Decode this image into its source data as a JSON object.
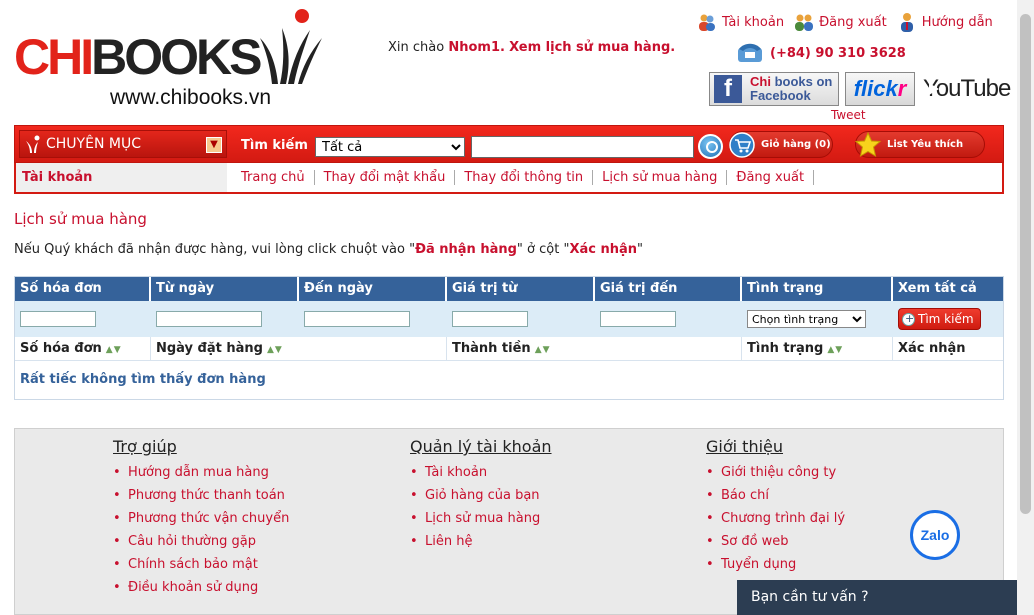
{
  "header": {
    "logo_chi": "CHI",
    "logo_books": "BOOKS",
    "logo_url": "www.chibooks.vn",
    "greeting_prefix": "Xin chào",
    "greeting_user": "Nhom1.",
    "greeting_history": "Xem lịch sử mua hàng.",
    "links": [
      {
        "label": "Tài khoản",
        "icon": "users-icon"
      },
      {
        "label": "Đăng xuất",
        "icon": "logout-icon"
      },
      {
        "label": "Hướng dẫn",
        "icon": "help-person-icon"
      }
    ],
    "phone": "(+84) 90 310 3628",
    "facebook_line1_a": "Chi",
    "facebook_line1_b": "books on",
    "facebook_line2": "Facebook",
    "flickr_a": "flick",
    "flickr_b": "r",
    "youtube": "YouTube",
    "tweet": "Tweet"
  },
  "nav": {
    "category": "CHUYÊN MỤC",
    "search_label": "Tìm kiếm",
    "search_scope": "Tất cả",
    "search_value": "",
    "cart": "Giỏ hàng (0)",
    "favorites": "List Yêu thích"
  },
  "subnav": {
    "section": "Tài khoản",
    "links": [
      "Trang chủ",
      "Thay đổi mật khẩu",
      "Thay đổi thông tin",
      "Lịch sử mua hàng",
      "Đăng xuất"
    ]
  },
  "main": {
    "title": "Lịch sử mua hàng",
    "notice_a": "Nếu Quý khách đã nhận được hàng, vui lòng click chuột vào \"",
    "notice_b": "Đã nhận hàng",
    "notice_c": "\" ở cột \"",
    "notice_d": "Xác nhận",
    "notice_e": "\""
  },
  "filter_table": {
    "headers": [
      "Số hóa đơn",
      "Từ ngày",
      "Đến ngày",
      "Giá trị từ",
      "Giá trị đến",
      "Tình trạng",
      "Xem tất cả"
    ],
    "status_select": "Chọn tình trạng",
    "search_button": "Tìm kiếm",
    "sort_headers": [
      "Số hóa đơn",
      "Ngày đặt hàng",
      "Thành tiền",
      "Tình trạng",
      "Xác nhận"
    ],
    "empty_message": "Rất tiếc không tìm thấy đơn hàng"
  },
  "footer": {
    "columns": [
      {
        "title": "Trợ giúp",
        "items": [
          "Hướng dẫn mua hàng",
          "Phương thức thanh toán",
          "Phương thức vận chuyển",
          "Câu hỏi thường gặp",
          "Chính sách bảo mật",
          "Điều khoản sử dụng"
        ]
      },
      {
        "title": "Quản lý tài khoản",
        "items": [
          "Tài khoản",
          "Giỏ hàng của bạn",
          "Lịch sử mua hàng",
          "Liên hệ"
        ]
      },
      {
        "title": "Giới thiệu",
        "items": [
          "Giới thiệu công ty",
          "Báo chí",
          "Chương trình đại lý",
          "Sơ đồ web",
          "Tuyển dụng"
        ]
      }
    ]
  },
  "widgets": {
    "zalo": "Zalo",
    "chat": "Bạn cần tư vấn ?"
  },
  "colors": {
    "brand_red": "#c8102e",
    "table_header_blue": "#35629a"
  }
}
